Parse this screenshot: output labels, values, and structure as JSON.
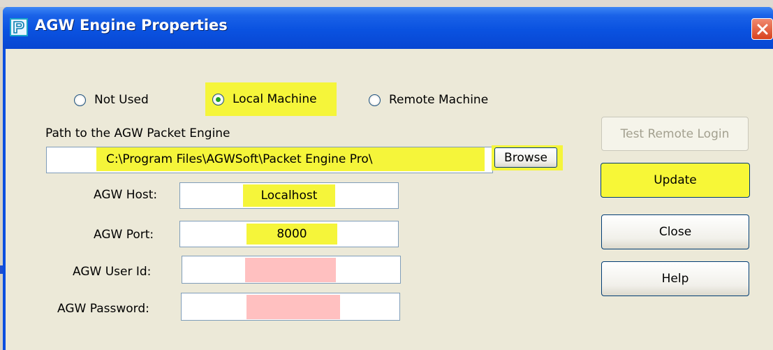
{
  "window": {
    "title": "AGW Engine Properties",
    "icon": "agw-app-icon",
    "close_icon": "close-icon"
  },
  "mode": {
    "options": [
      "Not Used",
      "Local Machine",
      "Remote Machine"
    ],
    "selected": "Local Machine"
  },
  "path": {
    "label": "Path to the AGW Packet Engine",
    "value": "C:\\Program Files\\AGWSoft\\Packet Engine Pro\\",
    "browse_label": "Browse"
  },
  "host": {
    "label": "AGW Host:",
    "value": "Localhost"
  },
  "port": {
    "label": "AGW Port:",
    "value": "8000"
  },
  "user": {
    "label": "AGW User Id:",
    "value": ""
  },
  "password": {
    "label": "AGW Password:",
    "value": ""
  },
  "buttons": {
    "test_remote": "Test Remote Login",
    "update": "Update",
    "close": "Close",
    "help": "Help"
  },
  "colors": {
    "highlight": "#f5f53a",
    "redacted": "#ffc0c0",
    "titlebar": "#0a52e0"
  }
}
